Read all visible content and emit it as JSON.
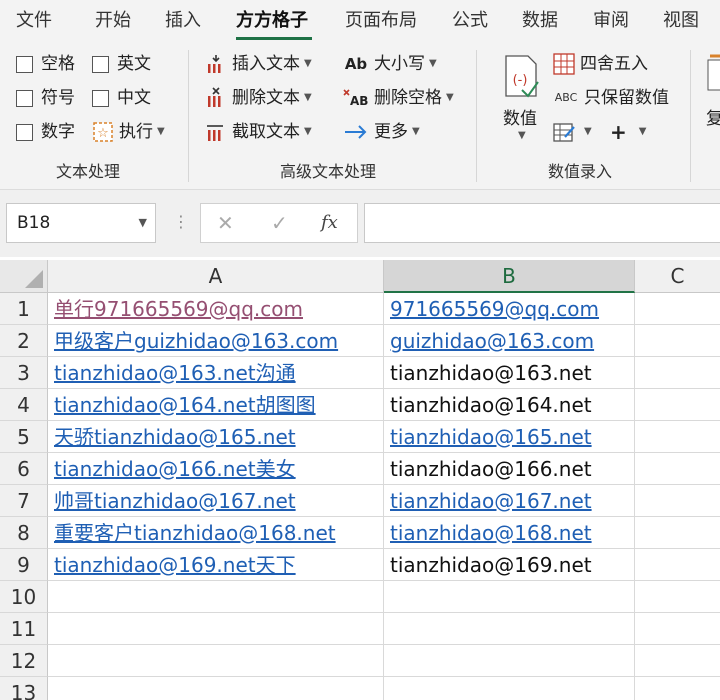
{
  "menu": {
    "tabs": [
      "文件",
      "开始",
      "插入",
      "方方格子",
      "页面布局",
      "公式",
      "数据",
      "审阅",
      "视图"
    ],
    "active_index": 3
  },
  "ribbon": {
    "text_group": {
      "label": "文本处理",
      "checkboxes": [
        "空格",
        "英文",
        "符号",
        "中文",
        "数字"
      ],
      "execute": "执行"
    },
    "advanced_group": {
      "label": "高级文本处理",
      "insert_text": "插入文本",
      "delete_text": "删除文本",
      "cut_text": "截取文本",
      "case": "大小写",
      "delete_space": "删除空格",
      "more": "更多"
    },
    "number_group": {
      "label": "数值录入",
      "value_btn": "数值",
      "round": "四舍五入",
      "keep_value": "只保留数值",
      "plus": "+"
    },
    "partial_btn": "复"
  },
  "formula_bar": {
    "name_box": "B18",
    "cancel_icon": "✕",
    "confirm_icon": "✓",
    "fx_label": "fx",
    "formula": ""
  },
  "sheet": {
    "columns": [
      "A",
      "B",
      "C"
    ],
    "selected_column": "B",
    "row_numbers": [
      "1",
      "2",
      "3",
      "4",
      "5",
      "6",
      "7",
      "8",
      "9",
      "10",
      "11",
      "12",
      "13"
    ],
    "rows": [
      {
        "a": "单行971665569@qq.com",
        "a_style": "visited",
        "b": "971665569@qq.com",
        "b_style": "link"
      },
      {
        "a": "甲级客户guizhidao@163.com",
        "a_style": "link",
        "b": "guizhidao@163.com",
        "b_style": "link"
      },
      {
        "a": "tianzhidao@163.net沟通",
        "a_style": "link",
        "b": "tianzhidao@163.net",
        "b_style": "plain"
      },
      {
        "a": "tianzhidao@164.net胡图图",
        "a_style": "link",
        "b": "tianzhidao@164.net",
        "b_style": "plain"
      },
      {
        "a": "天骄tianzhidao@165.net",
        "a_style": "link",
        "b": "tianzhidao@165.net",
        "b_style": "link"
      },
      {
        "a": "tianzhidao@166.net美女",
        "a_style": "link",
        "b": "tianzhidao@166.net",
        "b_style": "plain"
      },
      {
        "a": "帅哥tianzhidao@167.net",
        "a_style": "link",
        "b": "tianzhidao@167.net",
        "b_style": "link"
      },
      {
        "a": "重要客户tianzhidao@168.net",
        "a_style": "link",
        "b": "tianzhidao@168.net",
        "b_style": "link"
      },
      {
        "a": "tianzhidao@169.net天下",
        "a_style": "link",
        "b": "tianzhidao@169.net",
        "b_style": "plain"
      },
      {
        "a": "",
        "a_style": "plain",
        "b": "",
        "b_style": "plain"
      },
      {
        "a": "",
        "a_style": "plain",
        "b": "",
        "b_style": "plain"
      },
      {
        "a": "",
        "a_style": "plain",
        "b": "",
        "b_style": "plain"
      },
      {
        "a": "",
        "a_style": "plain",
        "b": "",
        "b_style": "plain"
      }
    ]
  },
  "colors": {
    "accent": "#217346",
    "link": "#1f5fb4",
    "visited": "#954f72"
  }
}
